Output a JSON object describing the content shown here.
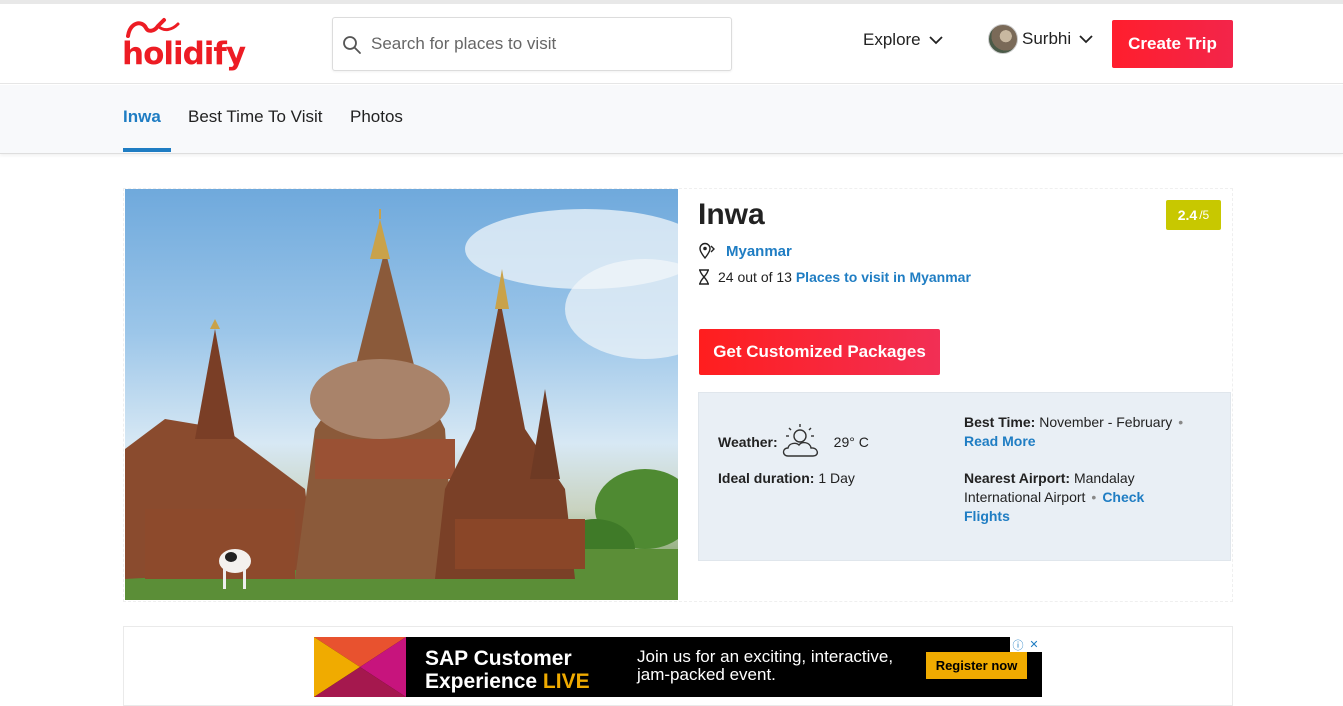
{
  "header": {
    "logo_text": "holidify",
    "search_placeholder": "Search for places to visit",
    "explore_label": "Explore",
    "user_name": "Surbhi",
    "create_trip_label": "Create Trip"
  },
  "tabs": [
    {
      "label": "Inwa",
      "active": true
    },
    {
      "label": "Best Time To Visit",
      "active": false
    },
    {
      "label": "Photos",
      "active": false
    }
  ],
  "place": {
    "title": "Inwa",
    "rating": "2.4",
    "rating_out_of": "/5",
    "country": "Myanmar",
    "rank_text": "24 out of 13",
    "rank_link": "Places to visit in Myanmar",
    "packages_button": "Get Customized Packages"
  },
  "info": {
    "weather_label": "Weather:",
    "weather_value": "29° C",
    "duration_label": "Ideal duration:",
    "duration_value": "1 Day",
    "best_time_label": "Best Time:",
    "best_time_value": "November - February",
    "read_more": "Read More",
    "airport_label": "Nearest Airport:",
    "airport_value": "Mandalay International Airport",
    "check_flights": "Check Flights"
  },
  "ad": {
    "title_line1": "SAP Customer",
    "title_line2a": "Experience",
    "title_line2b": "LIVE",
    "copy": "Join us for an exciting, interactive, jam-packed event.",
    "button": "Register now"
  },
  "colors": {
    "brand_red": "#ed1c24",
    "link_blue": "#1f7dc3",
    "rating_bg": "#c8c800",
    "info_bg": "#e9eff5"
  }
}
